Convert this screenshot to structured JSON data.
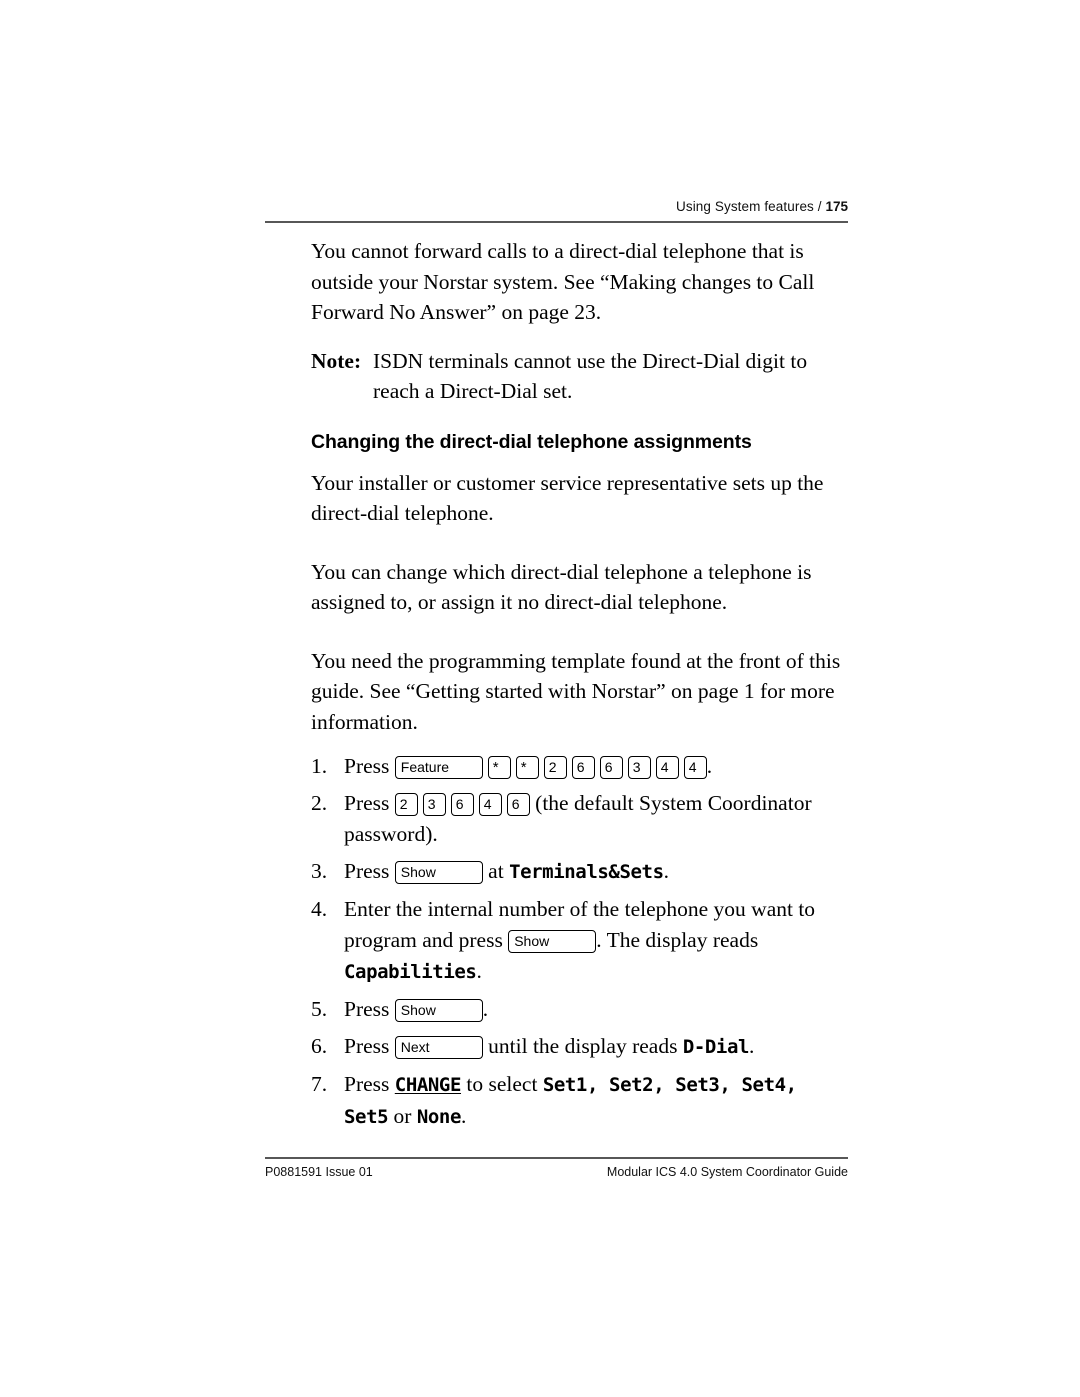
{
  "header": {
    "running_title": "Using System features / ",
    "page_number": "175"
  },
  "body": {
    "para1": "You cannot forward calls to a direct-dial telephone that is outside your Norstar system. See “Making changes to Call Forward No Answer” on page 23.",
    "note_label": "Note:",
    "note_text": "ISDN terminals cannot use the Direct-Dial digit to reach a Direct-Dial set.",
    "section_heading": "Changing the direct-dial telephone assignments",
    "para2": "Your installer or customer service representative sets up the direct-dial telephone.",
    "para3": "You can change which direct-dial telephone a telephone is assigned to, or assign it no direct-dial telephone.",
    "para4": "You need the programming template found at the front of this guide. See “Getting started with Norstar”  on page 1 for more information."
  },
  "steps": [
    {
      "num": "1.",
      "lead": "Press",
      "keys": [
        "Feature",
        "*",
        "*",
        "2",
        "6",
        "6",
        "3",
        "4",
        "4"
      ],
      "trail": "."
    },
    {
      "num": "2.",
      "lead": "Press",
      "keys": [
        "2",
        "3",
        "6",
        "4",
        "6"
      ],
      "trail": "(the default System Coordinator password)."
    },
    {
      "num": "3.",
      "lead": "Press",
      "key": "Show",
      "mid": "at",
      "display": "Terminals&Sets",
      "trail": "."
    },
    {
      "num": "4.",
      "lead": "Enter the internal number of the telephone you want to program and press",
      "key": "Show",
      "mid": ". The display reads",
      "display": "Capabilities",
      "trail": "."
    },
    {
      "num": "5.",
      "lead": "Press",
      "key": "Show",
      "trail": "."
    },
    {
      "num": "6.",
      "lead": "Press",
      "key": "Next",
      "mid": "until the display reads",
      "display": "D-Dial",
      "trail": "."
    },
    {
      "num": "7.",
      "lead": "Press",
      "softkey": "CHANGE",
      "mid": "to select",
      "options": "Set1, Set2, Set3, Set4, Set5",
      "conj": "or",
      "display2": "None",
      "trail": "."
    }
  ],
  "footer": {
    "left": "P0881591 Issue 01",
    "right": "Modular ICS 4.0 System Coordinator Guide"
  }
}
